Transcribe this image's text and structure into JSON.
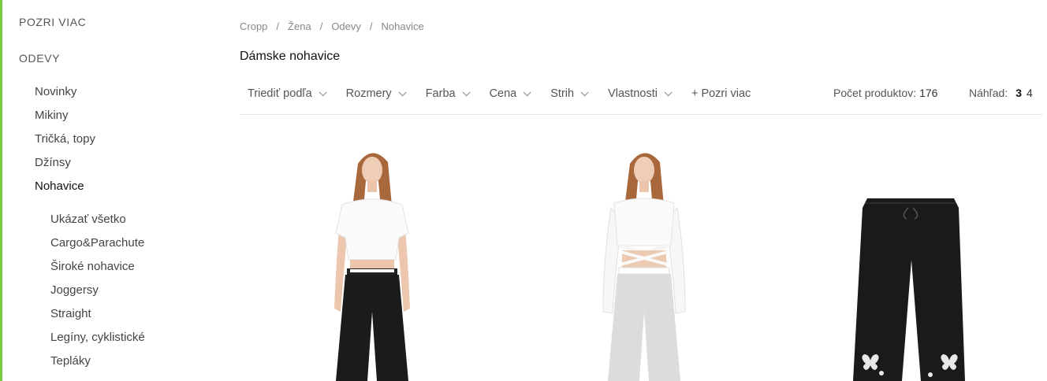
{
  "sidebar": {
    "more_label": "POZRI VIAC",
    "section_label": "ODEVY",
    "categories": [
      "Novinky",
      "Mikiny",
      "Tričká, topy",
      "Džínsy",
      "Nohavice"
    ],
    "subcategories": [
      "Ukázať všetko",
      "Cargo&Parachute",
      "Široké nohavice",
      "Joggersy",
      "Straight",
      "Legíny, cyklistické",
      "Tepláky"
    ]
  },
  "breadcrumb": [
    "Cropp",
    "Žena",
    "Odevy",
    "Nohavice"
  ],
  "page_title": "Dámske nohavice",
  "filters": {
    "sort": "Triediť podľa",
    "sizes": "Rozmery",
    "color": "Farba",
    "price": "Cena",
    "cut": "Strih",
    "features": "Vlastnosti",
    "more": "+ Pozri viac"
  },
  "product_count": {
    "label": "Počet produktov:",
    "value": "176"
  },
  "view": {
    "label": "Náhľad:",
    "options": [
      "3",
      "4"
    ]
  },
  "colors": {
    "accent": "#7ac943",
    "text": "#1a1a1a",
    "muted": "#888888"
  }
}
